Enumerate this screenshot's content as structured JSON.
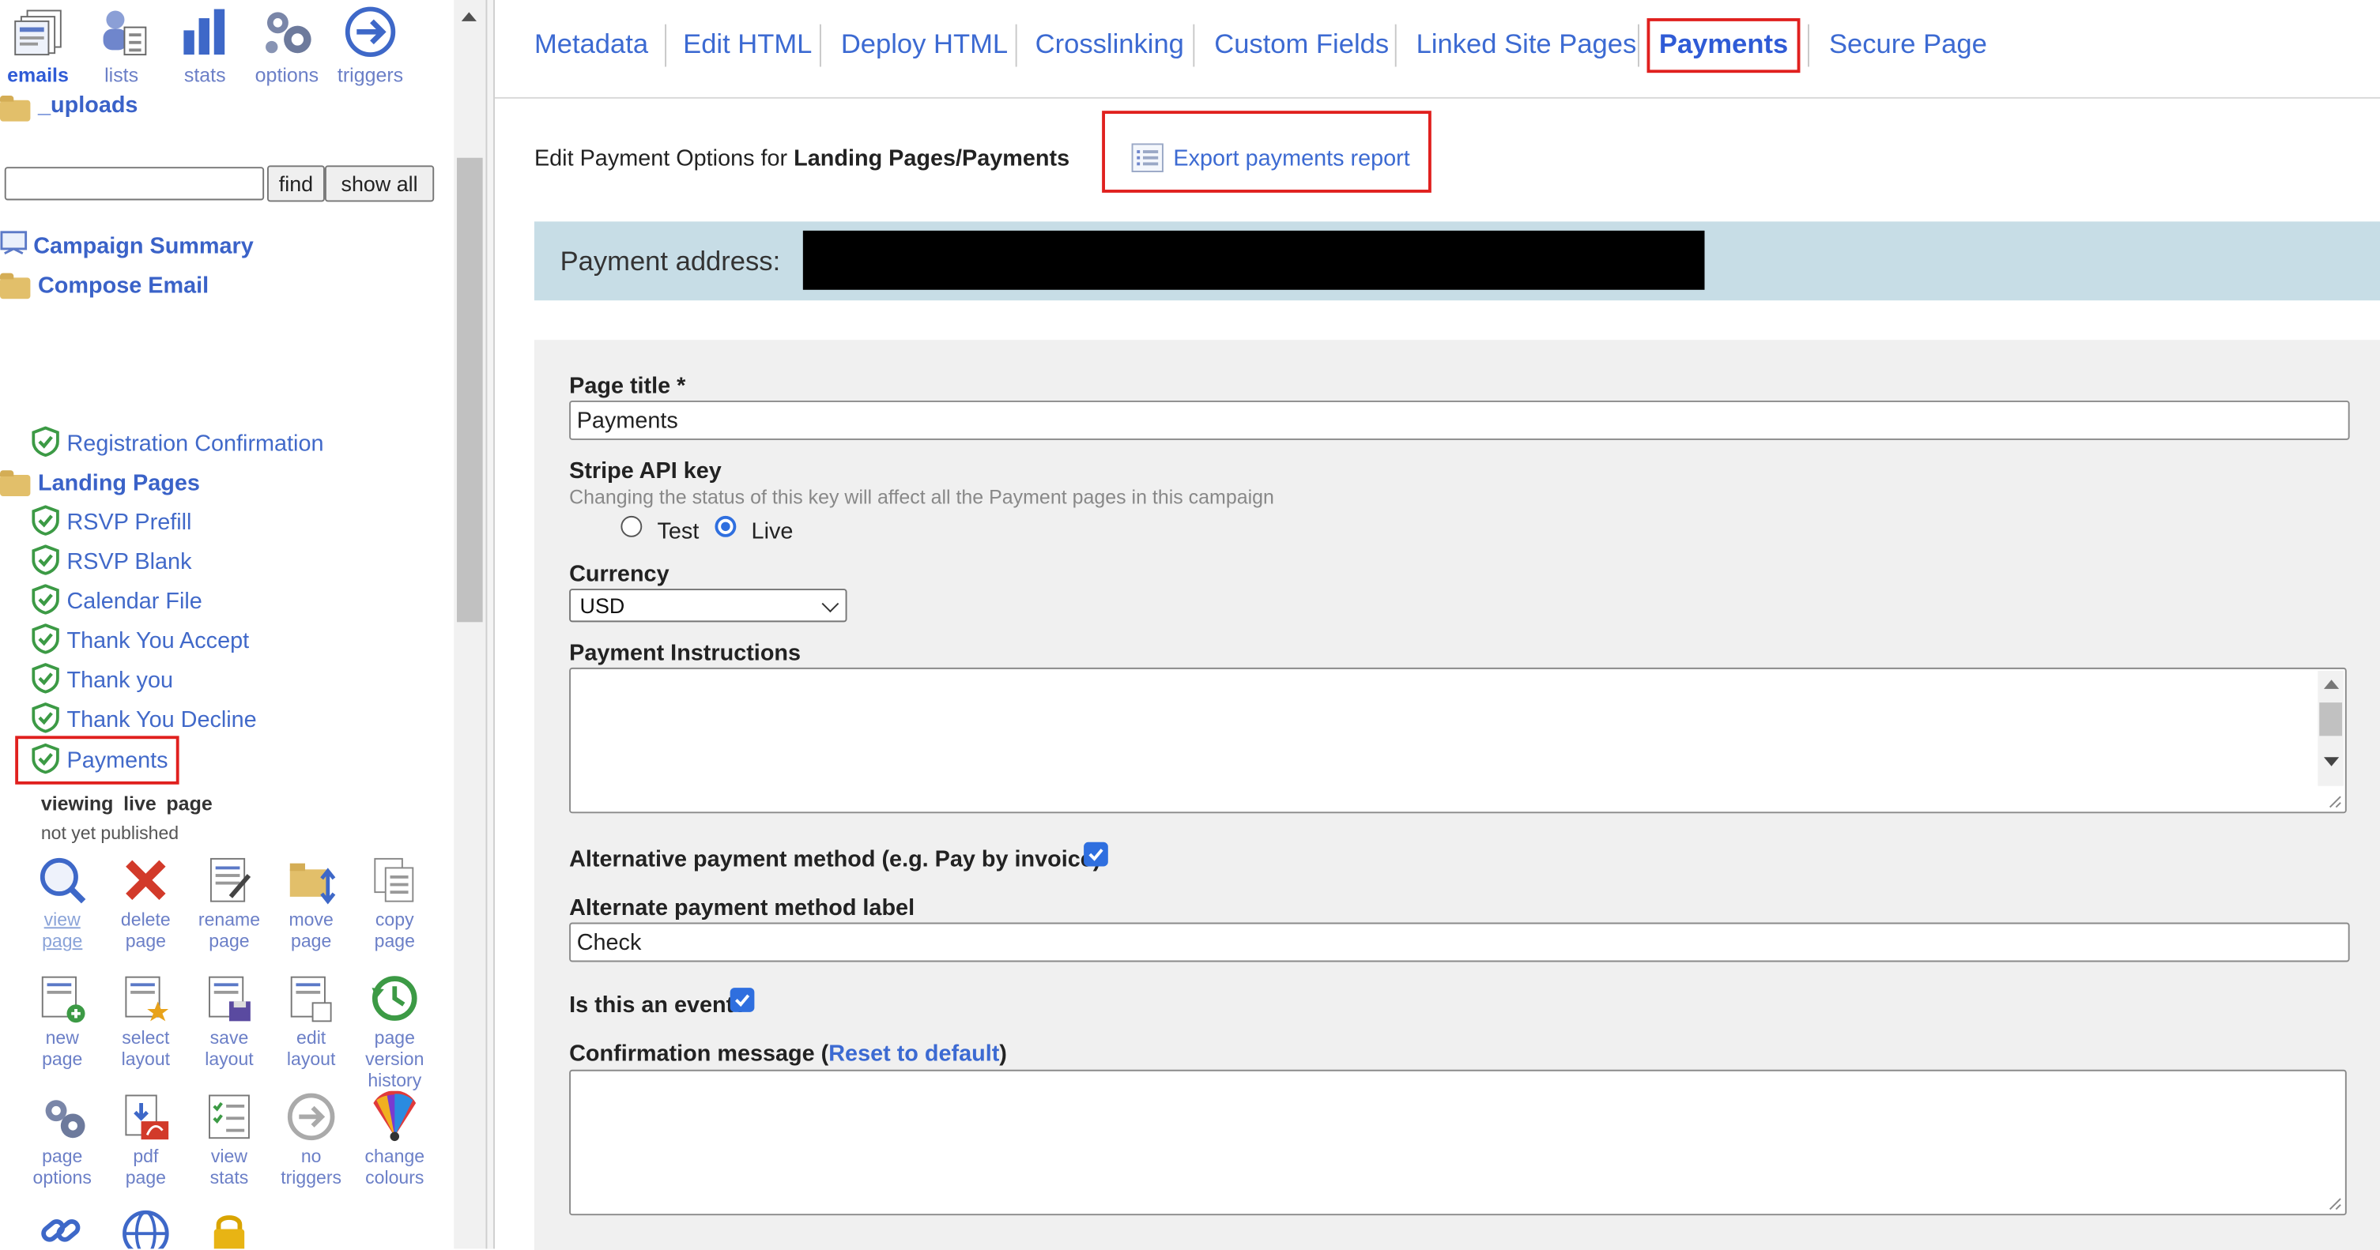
{
  "top_nav": [
    {
      "label": "emails",
      "icon": "emails-icon",
      "active": true
    },
    {
      "label": "lists",
      "icon": "lists-icon"
    },
    {
      "label": "stats",
      "icon": "stats-icon"
    },
    {
      "label": "options",
      "icon": "options-gear-icon"
    },
    {
      "label": "triggers",
      "icon": "triggers-arrow-icon"
    }
  ],
  "sidebar": {
    "uploads_label": "_uploads",
    "find_button": "find",
    "show_all_button": "show all",
    "search_value": "",
    "campaign_summary": "Campaign Summary",
    "compose_email": "Compose Email",
    "registration_confirmation": "Registration Confirmation",
    "landing_pages": "Landing Pages",
    "pages": [
      "RSVP Prefill",
      "RSVP Blank",
      "Calendar File",
      "Thank You Accept",
      "Thank you",
      "Thank You Decline",
      "Payments"
    ],
    "viewing_label": "viewing live page",
    "status": "not yet published",
    "tools": [
      {
        "label": "view\npage",
        "icon": "view-page-icon"
      },
      {
        "label": "delete\npage",
        "icon": "delete-icon"
      },
      {
        "label": "rename\npage",
        "icon": "rename-icon"
      },
      {
        "label": "move\npage",
        "icon": "move-icon"
      },
      {
        "label": "copy\npage",
        "icon": "copy-icon"
      },
      {
        "label": "new\npage",
        "icon": "new-page-icon"
      },
      {
        "label": "select\nlayout",
        "icon": "select-layout-icon"
      },
      {
        "label": "save\nlayout",
        "icon": "save-layout-icon"
      },
      {
        "label": "edit\nlayout",
        "icon": "edit-layout-icon"
      },
      {
        "label": "page\nversion\nhistory",
        "icon": "history-icon"
      },
      {
        "label": "page\noptions",
        "icon": "page-options-icon"
      },
      {
        "label": "pdf\npage",
        "icon": "pdf-icon"
      },
      {
        "label": "view\nstats",
        "icon": "view-stats-icon"
      },
      {
        "label": "no\ntriggers",
        "icon": "no-triggers-icon"
      },
      {
        "label": "change\ncolours",
        "icon": "colours-icon"
      }
    ]
  },
  "tabs": [
    "Metadata",
    "Edit HTML",
    "Deploy HTML",
    "Crosslinking",
    "Custom Fields",
    "Linked Site Pages",
    "Payments",
    "Secure Page"
  ],
  "active_tab": "Payments",
  "header": {
    "prefix": "Edit Payment Options for ",
    "page_path": "Landing Pages/Payments",
    "export_label": "Export payments report"
  },
  "payment_address_label": "Payment address:",
  "form": {
    "page_title_label": "Page title *",
    "page_title_value": "Payments",
    "stripe_label": "Stripe API key",
    "stripe_hint": "Changing the status of this key will affect all the Payment pages in this campaign",
    "stripe_test": "Test",
    "stripe_live": "Live",
    "stripe_selected": "Live",
    "currency_label": "Currency",
    "currency_value": "USD",
    "instructions_label": "Payment Instructions",
    "instructions_value": "",
    "alt_method_label": "Alternative payment method (e.g. Pay by invoice)",
    "alt_method_checked": true,
    "alt_label_label": "Alternate payment method label",
    "alt_label_value": "Check",
    "is_event_label": "Is this an event?",
    "is_event_checked": true,
    "confirmation_label": "Confirmation message (",
    "reset_link": "Reset to default",
    "confirmation_close": ")",
    "confirmation_value": ""
  },
  "colors": {
    "accent": "#3c6ad2",
    "highlight": "#e0201e",
    "address_bar": "#c7dde6"
  }
}
